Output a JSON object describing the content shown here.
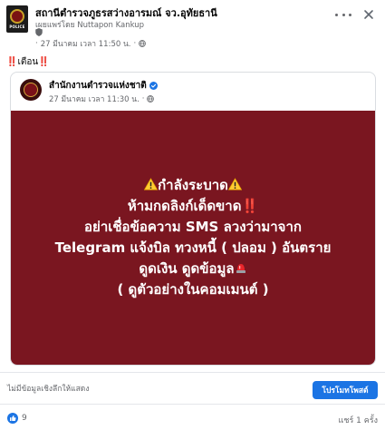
{
  "post": {
    "page_name": "สถานีตำรวจภูธรสว่างอารมณ์ จว.อุทัยธานี",
    "posted_by": "เผยแพร่โดย Nuttapon Kankup",
    "timestamp": "27 มีนาคม เวลา 11:50 น.",
    "time_sep": "·",
    "caption_prefix": "‼️",
    "caption_text": "เตือน",
    "caption_suffix": "‼️"
  },
  "shared": {
    "page_name": "สำนักงานตำรวจแห่งชาติ",
    "timestamp": "27 มีนาคม เวลา 11:30 น.",
    "time_sep": "·",
    "banner": {
      "line1": "กำลังระบาด",
      "line2": "ห้ามกดลิงก์เด็ดขาด",
      "line2_suffix": "‼️",
      "line3": "อย่าเชื่อข้อความ SMS ลวงว่ามาจาก",
      "line4": "Telegram แจ้งบิล ทวงหนี้ ( ปลอม ) อันตราย",
      "line5": "ดูดเงิน ดูดข้อมูล",
      "line6": "( ดูตัวอย่างในคอมเมนต์ )"
    },
    "colors": {
      "banner_bg": "#7a1620",
      "text": "#ffffff"
    }
  },
  "promo": {
    "note": "ไม่มีข้อมูลเชิงลึกให้แสดง",
    "button_label": "โปรโมทโพสต์",
    "button_color": "#1b74e4"
  },
  "footer": {
    "like_count": "9",
    "shares": "แชร์ 1 ครั้ง"
  },
  "icons": [
    "police-logo-icon",
    "shield-icon",
    "globe-icon",
    "more-icon",
    "close-icon",
    "verified-icon",
    "warning-icon",
    "siren-icon",
    "like-icon"
  ]
}
